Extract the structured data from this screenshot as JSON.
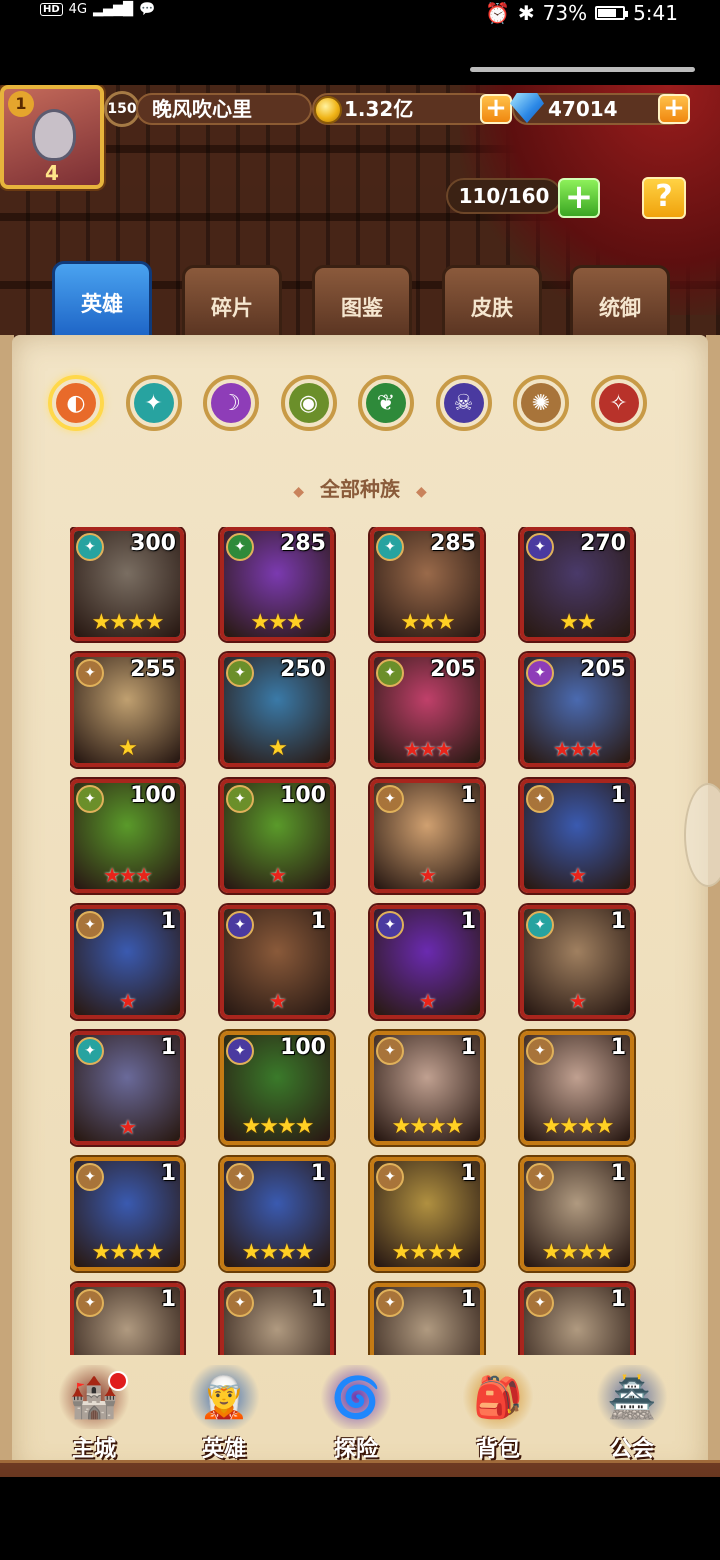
{
  "status_bar": {
    "left_badge": "HD",
    "signal": "4G",
    "battery_percent": "73%",
    "battery_level": 0.73,
    "time": "5:41"
  },
  "player": {
    "level": "150",
    "name": "晚风吹心里",
    "gold": "1.32亿",
    "gems": "47014",
    "vip": "1",
    "rank": "4"
  },
  "hero_capacity": "110/160",
  "help_label": "?",
  "tabs": [
    "英雄",
    "碎片",
    "图鉴",
    "皮肤",
    "统御"
  ],
  "filters": [
    {
      "name": "all-races-filter",
      "glyph": "◐",
      "color": "#e86a2a"
    },
    {
      "name": "race-filter-1",
      "glyph": "✦",
      "color": "#27a3a0"
    },
    {
      "name": "race-filter-2",
      "glyph": "☽",
      "color": "#8e3db8"
    },
    {
      "name": "race-filter-3",
      "glyph": "◉",
      "color": "#6b8f2a"
    },
    {
      "name": "race-filter-4",
      "glyph": "❦",
      "color": "#2e8a3a"
    },
    {
      "name": "race-filter-5",
      "glyph": "☠",
      "color": "#4a3aa0"
    },
    {
      "name": "race-filter-6",
      "glyph": "✺",
      "color": "#a8743a"
    },
    {
      "name": "race-filter-7",
      "glyph": "✧",
      "color": "#b8322a"
    }
  ],
  "race_title": "全部种族",
  "heroes": [
    {
      "level": "300",
      "stars": "★★★★",
      "star_type": "gold",
      "race_color": "#27a3a0",
      "bg": "#7a6e62"
    },
    {
      "level": "285",
      "stars": "★★★",
      "star_type": "gold",
      "race_color": "#2e8a3a",
      "bg": "#7b3ab0"
    },
    {
      "level": "285",
      "stars": "★★★",
      "star_type": "gold",
      "race_color": "#27a3a0",
      "bg": "#9a6a4a"
    },
    {
      "level": "270",
      "stars": "★★",
      "star_type": "gold",
      "race_color": "#4a3aa0",
      "bg": "#4a3a6a"
    },
    {
      "level": "255",
      "stars": "★",
      "star_type": "gold",
      "race_color": "#a8743a",
      "bg": "#c0a070"
    },
    {
      "level": "250",
      "stars": "★",
      "star_type": "gold",
      "race_color": "#6b8f2a",
      "bg": "#3a7aa8"
    },
    {
      "level": "205",
      "stars": "★★★",
      "star_type": "red",
      "race_color": "#6b8f2a",
      "bg": "#c0406a"
    },
    {
      "level": "205",
      "stars": "★★★",
      "star_type": "red",
      "race_color": "#8e3db8",
      "bg": "#4a6ab0"
    },
    {
      "level": "100",
      "stars": "★★★",
      "star_type": "red",
      "race_color": "#6b8f2a",
      "bg": "#5a9a2a"
    },
    {
      "level": "100",
      "stars": "★",
      "star_type": "red",
      "race_color": "#6b8f2a",
      "bg": "#5a9a2a"
    },
    {
      "level": "1",
      "stars": "★",
      "star_type": "red",
      "race_color": "#a8743a",
      "bg": "#d0a070"
    },
    {
      "level": "1",
      "stars": "★",
      "star_type": "red",
      "race_color": "#a8743a",
      "bg": "#3a5ab0"
    },
    {
      "level": "1",
      "stars": "★",
      "star_type": "red",
      "race_color": "#a8743a",
      "bg": "#3a5ab0"
    },
    {
      "level": "1",
      "stars": "★",
      "star_type": "red",
      "race_color": "#4a3aa0",
      "bg": "#8a5a3a"
    },
    {
      "level": "1",
      "stars": "★",
      "star_type": "red",
      "race_color": "#4a3aa0",
      "bg": "#6a2ab0"
    },
    {
      "level": "1",
      "stars": "★",
      "star_type": "red",
      "race_color": "#27a3a0",
      "bg": "#a08060"
    },
    {
      "level": "1",
      "stars": "★",
      "star_type": "red",
      "race_color": "#27a3a0",
      "bg": "#6a6a9a"
    },
    {
      "level": "100",
      "stars": "★★★★",
      "star_type": "gold",
      "race_color": "#4a3aa0",
      "bg": "#3a7a2a",
      "gold_frame": true
    },
    {
      "level": "1",
      "stars": "★★★★",
      "star_type": "gold",
      "race_color": "#a8743a",
      "bg": "#c0a090",
      "gold_frame": true
    },
    {
      "level": "1",
      "stars": "★★★★",
      "star_type": "gold",
      "race_color": "#a8743a",
      "bg": "#c0a090",
      "gold_frame": true
    },
    {
      "level": "1",
      "stars": "★★★★",
      "star_type": "gold",
      "race_color": "#a8743a",
      "bg": "#3a5ab0",
      "gold_frame": true
    },
    {
      "level": "1",
      "stars": "★★★★",
      "star_type": "gold",
      "race_color": "#a8743a",
      "bg": "#3a5ab0",
      "gold_frame": true
    },
    {
      "level": "1",
      "stars": "★★★★",
      "star_type": "gold",
      "race_color": "#a8743a",
      "bg": "#b09040",
      "gold_frame": true
    },
    {
      "level": "1",
      "stars": "★★★★",
      "star_type": "gold",
      "race_color": "#a8743a",
      "bg": "#b09a80",
      "gold_frame": true
    },
    {
      "level": "1",
      "stars": "",
      "star_type": "gold",
      "race_color": "#a8743a",
      "bg": "#b09a80"
    },
    {
      "level": "1",
      "stars": "",
      "star_type": "gold",
      "race_color": "#a8743a",
      "bg": "#b09a80"
    },
    {
      "level": "1",
      "stars": "",
      "star_type": "gold",
      "race_color": "#a8743a",
      "bg": "#b09a80",
      "gold_frame": true
    },
    {
      "level": "1",
      "stars": "",
      "star_type": "gold",
      "race_color": "#a8743a",
      "bg": "#b09a80"
    }
  ],
  "bottom_nav": [
    {
      "label": "主城",
      "icon": "castle-icon",
      "glyph": "🏰",
      "color": "#8a3a2a"
    },
    {
      "label": "英雄",
      "icon": "hero-icon",
      "glyph": "🧝",
      "color": "#3a6ab0"
    },
    {
      "label": "探险",
      "icon": "portal-icon",
      "glyph": "🌀",
      "color": "#6a3ab0"
    },
    {
      "label": "背包",
      "icon": "bag-icon",
      "glyph": "🎒",
      "color": "#d08a1a"
    },
    {
      "label": "公会",
      "icon": "guild-icon",
      "glyph": "🏯",
      "color": "#5a6a9a"
    }
  ]
}
